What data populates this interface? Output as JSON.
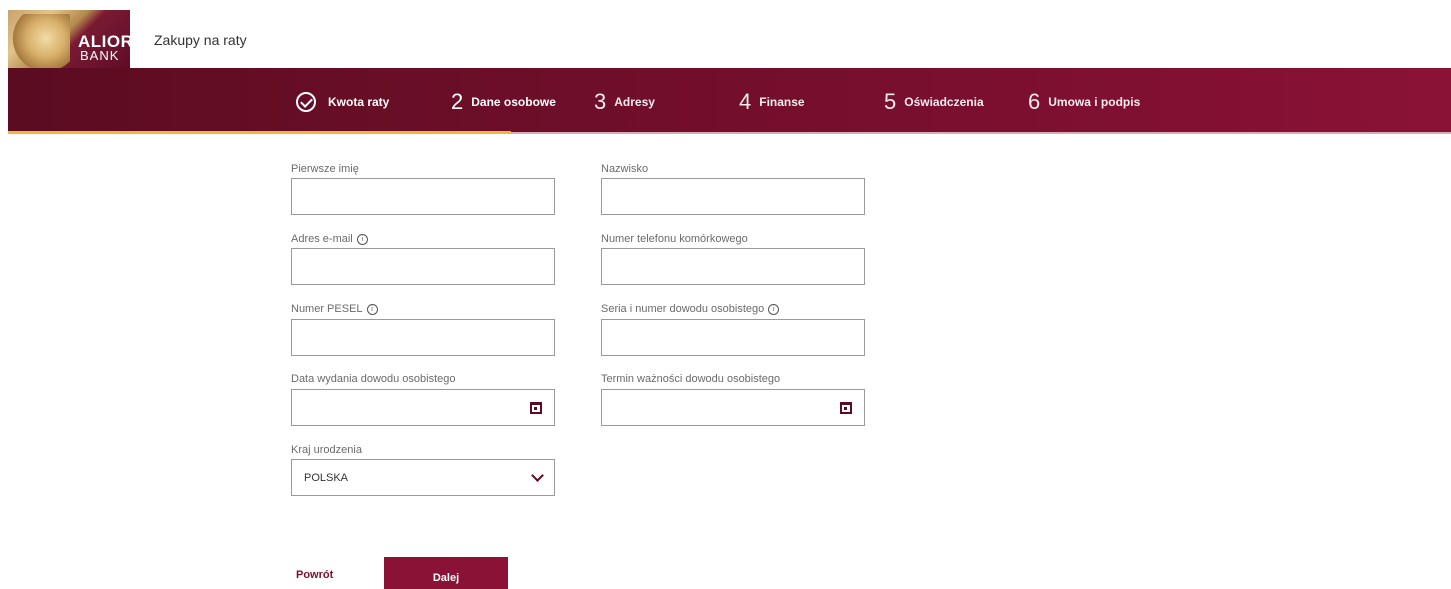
{
  "brand": {
    "logo_line1": "ALIOR",
    "logo_line2": "BANK",
    "app_title": "Zakupy na raty",
    "colors": {
      "primary": "#7c0f30",
      "primary_dark": "#5b0c21",
      "accent": "#f1b63b"
    }
  },
  "steps": [
    {
      "num": "",
      "label": "Kwota raty",
      "state": "done",
      "icon": "check-circle-icon"
    },
    {
      "num": "2",
      "label": "Dane osobowe",
      "state": "active"
    },
    {
      "num": "3",
      "label": "Adresy",
      "state": "pending"
    },
    {
      "num": "4",
      "label": "Finanse",
      "state": "pending"
    },
    {
      "num": "5",
      "label": "Oświadczenia",
      "state": "pending"
    },
    {
      "num": "6",
      "label": "Umowa i podpis",
      "state": "pending"
    }
  ],
  "form": {
    "first_name": {
      "label": "Pierwsze imię",
      "value": ""
    },
    "last_name": {
      "label": "Nazwisko",
      "value": ""
    },
    "email": {
      "label": "Adres e-mail",
      "value": "",
      "icon": "info-icon"
    },
    "phone": {
      "label": "Numer telefonu komórkowego",
      "value": ""
    },
    "pesel": {
      "label": "Numer PESEL",
      "value": "",
      "icon": "info-icon"
    },
    "id_number": {
      "label": "Seria i numer dowodu osobistego",
      "value": "",
      "icon": "info-icon"
    },
    "id_issue_date": {
      "label": "Data wydania dowodu osobistego",
      "value": "",
      "icon": "calendar-icon"
    },
    "id_expiry_date": {
      "label": "Termin ważności dowodu osobistego",
      "value": "",
      "icon": "calendar-icon"
    },
    "birth_country": {
      "label": "Kraj urodzenia",
      "selected": "POLSKA",
      "icon": "chevron-down-icon"
    }
  },
  "actions": {
    "back_label": "Powrót",
    "next_label": "Dalej"
  }
}
